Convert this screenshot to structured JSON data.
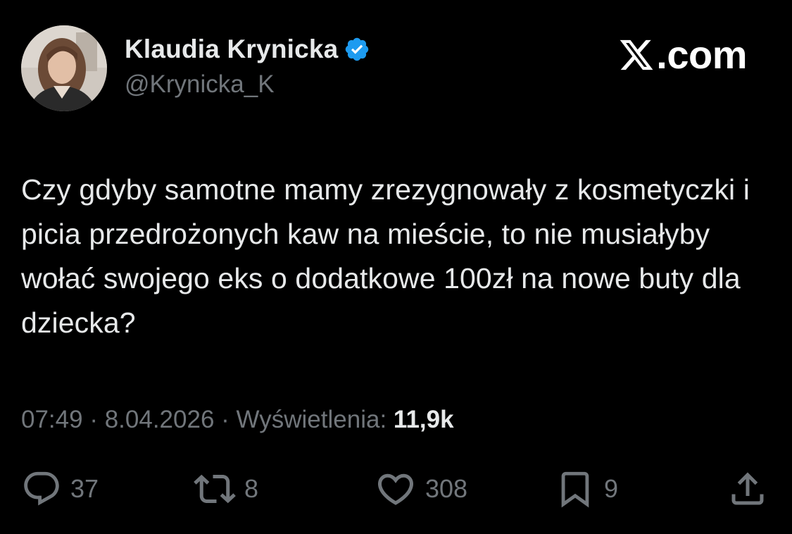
{
  "author": {
    "display_name": "Klaudia Krynicka",
    "handle": "@Krynicka_K",
    "verified": true,
    "verified_color": "#1d9bf0"
  },
  "brand": {
    "text": ".com",
    "icon": "x-logo-icon"
  },
  "tweet": {
    "text": "Czy gdyby samotne mamy zrezygnowały z kosmetyczki i picia przedrożonych kaw na mieście, to nie musiałyby wołać swojego eks o dodatkowe 100zł na nowe buty dla dziecka?"
  },
  "meta": {
    "time": "07:49",
    "separator1": " · ",
    "date": "8.04.2026",
    "separator2": " · ",
    "views_label": "Wyświetlenia: ",
    "views_count": "11,9k"
  },
  "actions": {
    "reply": {
      "icon": "reply-icon",
      "count": "37"
    },
    "retweet": {
      "icon": "retweet-icon",
      "count": "8"
    },
    "like": {
      "icon": "heart-icon",
      "count": "308"
    },
    "bookmark": {
      "icon": "bookmark-icon",
      "count": "9"
    },
    "share": {
      "icon": "share-icon"
    }
  },
  "colors": {
    "background": "#000000",
    "text": "#e7e9ea",
    "muted": "#71767b"
  }
}
